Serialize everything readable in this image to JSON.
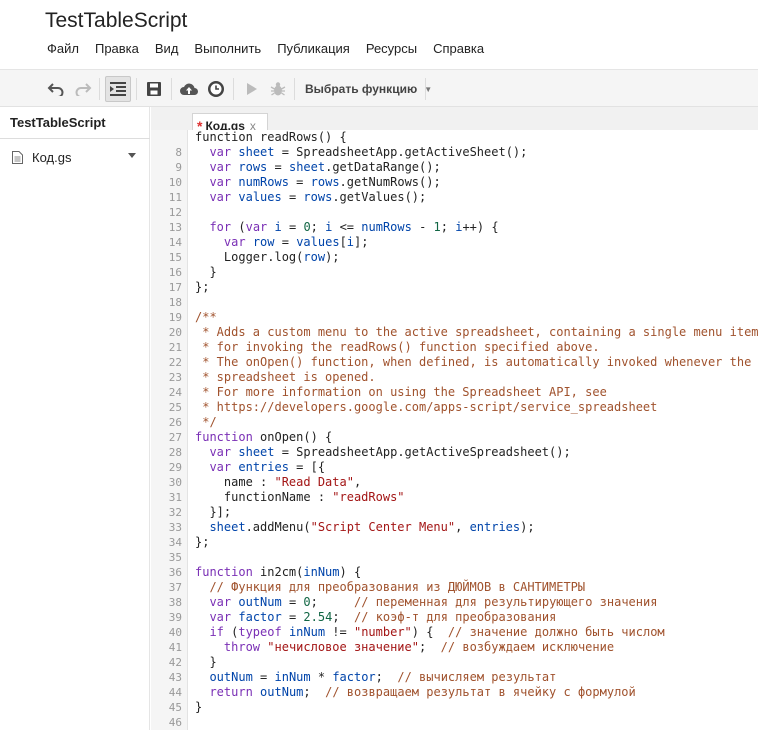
{
  "app": {
    "title": "TestTableScript"
  },
  "menu": [
    {
      "label": "Файл"
    },
    {
      "label": "Правка"
    },
    {
      "label": "Вид"
    },
    {
      "label": "Выполнить"
    },
    {
      "label": "Публикация"
    },
    {
      "label": "Ресурсы"
    },
    {
      "label": "Справка"
    }
  ],
  "toolbar": {
    "icons": [
      "undo-icon",
      "redo-icon",
      "indent-icon",
      "save-icon",
      "cloud-upload-icon",
      "clock-trigger-icon",
      "run-icon",
      "debug-icon"
    ],
    "function_select": "Выбрать функцию"
  },
  "sidebar": {
    "project_name": "TestTableScript",
    "files": [
      {
        "name": "Код.gs"
      }
    ]
  },
  "tabs": [
    {
      "label": "Код.gs",
      "modified": "*",
      "close": "x"
    }
  ],
  "editor": {
    "lines": [
      {
        "num": "",
        "tokens": [
          [
            "plain",
            "function readRows() {"
          ]
        ]
      },
      {
        "num": "8",
        "tokens": [
          [
            "plain",
            "  "
          ],
          [
            "kw",
            "var"
          ],
          [
            "plain",
            " "
          ],
          [
            "var",
            "sheet"
          ],
          [
            "plain",
            " = SpreadsheetApp.getActiveSheet();"
          ]
        ]
      },
      {
        "num": "9",
        "tokens": [
          [
            "plain",
            "  "
          ],
          [
            "kw",
            "var"
          ],
          [
            "plain",
            " "
          ],
          [
            "var",
            "rows"
          ],
          [
            "plain",
            " = "
          ],
          [
            "var",
            "sheet"
          ],
          [
            "plain",
            ".getDataRange();"
          ]
        ]
      },
      {
        "num": "10",
        "tokens": [
          [
            "plain",
            "  "
          ],
          [
            "kw",
            "var"
          ],
          [
            "plain",
            " "
          ],
          [
            "var",
            "numRows"
          ],
          [
            "plain",
            " = "
          ],
          [
            "var",
            "rows"
          ],
          [
            "plain",
            ".getNumRows();"
          ]
        ]
      },
      {
        "num": "11",
        "tokens": [
          [
            "plain",
            "  "
          ],
          [
            "kw",
            "var"
          ],
          [
            "plain",
            " "
          ],
          [
            "var",
            "values"
          ],
          [
            "plain",
            " = "
          ],
          [
            "var",
            "rows"
          ],
          [
            "plain",
            ".getValues();"
          ]
        ]
      },
      {
        "num": "12",
        "tokens": []
      },
      {
        "num": "13",
        "tokens": [
          [
            "plain",
            "  "
          ],
          [
            "kw",
            "for"
          ],
          [
            "plain",
            " ("
          ],
          [
            "kw",
            "var"
          ],
          [
            "plain",
            " "
          ],
          [
            "var",
            "i"
          ],
          [
            "plain",
            " = "
          ],
          [
            "num",
            "0"
          ],
          [
            "plain",
            "; "
          ],
          [
            "var",
            "i"
          ],
          [
            "plain",
            " <= "
          ],
          [
            "var",
            "numRows"
          ],
          [
            "plain",
            " - "
          ],
          [
            "num",
            "1"
          ],
          [
            "plain",
            "; "
          ],
          [
            "var",
            "i"
          ],
          [
            "plain",
            "++) {"
          ]
        ]
      },
      {
        "num": "14",
        "tokens": [
          [
            "plain",
            "    "
          ],
          [
            "kw",
            "var"
          ],
          [
            "plain",
            " "
          ],
          [
            "var",
            "row"
          ],
          [
            "plain",
            " = "
          ],
          [
            "var",
            "values"
          ],
          [
            "plain",
            "["
          ],
          [
            "var",
            "i"
          ],
          [
            "plain",
            "];"
          ]
        ]
      },
      {
        "num": "15",
        "tokens": [
          [
            "plain",
            "    Logger.log("
          ],
          [
            "var",
            "row"
          ],
          [
            "plain",
            ");"
          ]
        ]
      },
      {
        "num": "16",
        "tokens": [
          [
            "plain",
            "  }"
          ]
        ]
      },
      {
        "num": "17",
        "tokens": [
          [
            "plain",
            "};"
          ]
        ]
      },
      {
        "num": "18",
        "tokens": []
      },
      {
        "num": "19",
        "tokens": [
          [
            "com",
            "/**"
          ]
        ]
      },
      {
        "num": "20",
        "tokens": [
          [
            "com",
            " * Adds a custom menu to the active spreadsheet, containing a single menu item"
          ]
        ]
      },
      {
        "num": "21",
        "tokens": [
          [
            "com",
            " * for invoking the readRows() function specified above."
          ]
        ]
      },
      {
        "num": "22",
        "tokens": [
          [
            "com",
            " * The onOpen() function, when defined, is automatically invoked whenever the"
          ]
        ]
      },
      {
        "num": "23",
        "tokens": [
          [
            "com",
            " * spreadsheet is opened."
          ]
        ]
      },
      {
        "num": "24",
        "tokens": [
          [
            "com",
            " * For more information on using the Spreadsheet API, see"
          ]
        ]
      },
      {
        "num": "25",
        "tokens": [
          [
            "com",
            " * https://developers.google.com/apps-script/service_spreadsheet"
          ]
        ]
      },
      {
        "num": "26",
        "tokens": [
          [
            "com",
            " */"
          ]
        ]
      },
      {
        "num": "27",
        "tokens": [
          [
            "kw",
            "function"
          ],
          [
            "plain",
            " onOpen() {"
          ]
        ]
      },
      {
        "num": "28",
        "tokens": [
          [
            "plain",
            "  "
          ],
          [
            "kw",
            "var"
          ],
          [
            "plain",
            " "
          ],
          [
            "var",
            "sheet"
          ],
          [
            "plain",
            " = SpreadsheetApp.getActiveSpreadsheet();"
          ]
        ]
      },
      {
        "num": "29",
        "tokens": [
          [
            "plain",
            "  "
          ],
          [
            "kw",
            "var"
          ],
          [
            "plain",
            " "
          ],
          [
            "var",
            "entries"
          ],
          [
            "plain",
            " = [{"
          ]
        ]
      },
      {
        "num": "30",
        "tokens": [
          [
            "plain",
            "    name : "
          ],
          [
            "str",
            "\"Read Data\""
          ],
          [
            "plain",
            ","
          ]
        ]
      },
      {
        "num": "31",
        "tokens": [
          [
            "plain",
            "    functionName : "
          ],
          [
            "str",
            "\"readRows\""
          ]
        ]
      },
      {
        "num": "32",
        "tokens": [
          [
            "plain",
            "  }];"
          ]
        ]
      },
      {
        "num": "33",
        "tokens": [
          [
            "plain",
            "  "
          ],
          [
            "var",
            "sheet"
          ],
          [
            "plain",
            ".addMenu("
          ],
          [
            "str",
            "\"Script Center Menu\""
          ],
          [
            "plain",
            ", "
          ],
          [
            "var",
            "entries"
          ],
          [
            "plain",
            ");"
          ]
        ]
      },
      {
        "num": "34",
        "tokens": [
          [
            "plain",
            "};"
          ]
        ]
      },
      {
        "num": "35",
        "tokens": []
      },
      {
        "num": "36",
        "tokens": [
          [
            "kw",
            "function"
          ],
          [
            "plain",
            " in2cm("
          ],
          [
            "var",
            "inNum"
          ],
          [
            "plain",
            ") {"
          ]
        ]
      },
      {
        "num": "37",
        "tokens": [
          [
            "plain",
            "  "
          ],
          [
            "com",
            "// Функция для преобразования из ДЮЙМОВ в САНТИМЕТРЫ"
          ]
        ]
      },
      {
        "num": "38",
        "tokens": [
          [
            "plain",
            "  "
          ],
          [
            "kw",
            "var"
          ],
          [
            "plain",
            " "
          ],
          [
            "var",
            "outNum"
          ],
          [
            "plain",
            " = "
          ],
          [
            "num",
            "0"
          ],
          [
            "plain",
            ";     "
          ],
          [
            "com",
            "// переменная для результирующего значения"
          ]
        ]
      },
      {
        "num": "39",
        "tokens": [
          [
            "plain",
            "  "
          ],
          [
            "kw",
            "var"
          ],
          [
            "plain",
            " "
          ],
          [
            "var",
            "factor"
          ],
          [
            "plain",
            " = "
          ],
          [
            "num",
            "2.54"
          ],
          [
            "plain",
            ";  "
          ],
          [
            "com",
            "// коэф-т для преобразования"
          ]
        ]
      },
      {
        "num": "40",
        "tokens": [
          [
            "plain",
            "  "
          ],
          [
            "kw",
            "if"
          ],
          [
            "plain",
            " ("
          ],
          [
            "kw",
            "typeof"
          ],
          [
            "plain",
            " "
          ],
          [
            "var",
            "inNum"
          ],
          [
            "plain",
            " != "
          ],
          [
            "str",
            "\"number\""
          ],
          [
            "plain",
            ") {  "
          ],
          [
            "com",
            "// значение должно быть числом"
          ]
        ]
      },
      {
        "num": "41",
        "tokens": [
          [
            "plain",
            "    "
          ],
          [
            "kw",
            "throw"
          ],
          [
            "plain",
            " "
          ],
          [
            "str",
            "\"нечисловое значение\""
          ],
          [
            "plain",
            ";  "
          ],
          [
            "com",
            "// возбуждаем исключение"
          ]
        ]
      },
      {
        "num": "42",
        "tokens": [
          [
            "plain",
            "  }"
          ]
        ]
      },
      {
        "num": "43",
        "tokens": [
          [
            "plain",
            "  "
          ],
          [
            "var",
            "outNum"
          ],
          [
            "plain",
            " = "
          ],
          [
            "var",
            "inNum"
          ],
          [
            "plain",
            " * "
          ],
          [
            "var",
            "factor"
          ],
          [
            "plain",
            ";  "
          ],
          [
            "com",
            "// вычисляем результат"
          ]
        ]
      },
      {
        "num": "44",
        "tokens": [
          [
            "plain",
            "  "
          ],
          [
            "kw",
            "return"
          ],
          [
            "plain",
            " "
          ],
          [
            "var",
            "outNum"
          ],
          [
            "plain",
            ";  "
          ],
          [
            "com",
            "// возвращаем результат в ячейку с формулой"
          ]
        ]
      },
      {
        "num": "45",
        "tokens": [
          [
            "plain",
            "}"
          ]
        ]
      },
      {
        "num": "46",
        "tokens": []
      }
    ]
  }
}
